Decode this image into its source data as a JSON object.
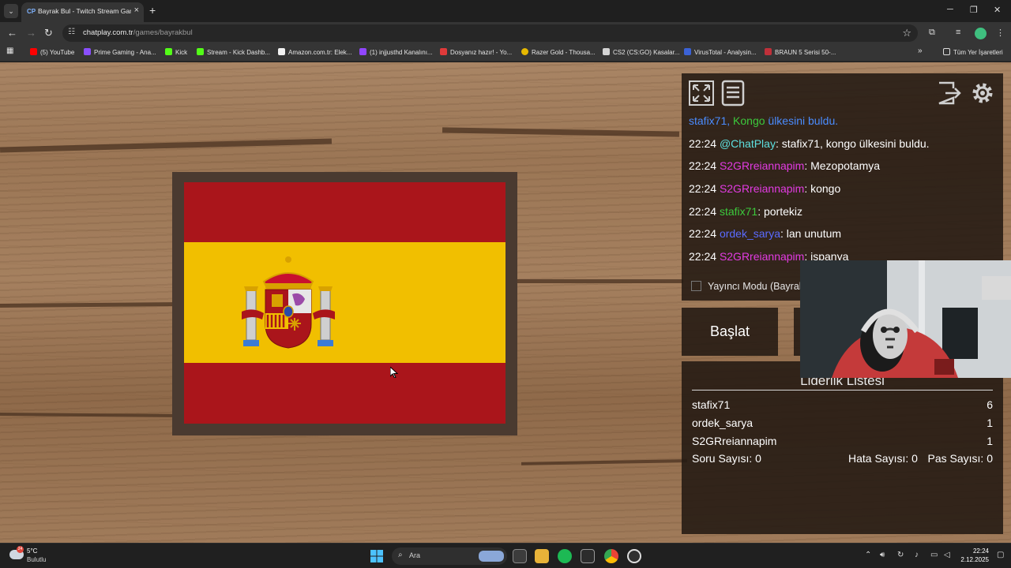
{
  "browser": {
    "tab": {
      "favicon": "CP",
      "title": "Bayrak Bul - Twitch Stream Game"
    },
    "url": {
      "host": "chatplay.com.tr",
      "path": "/games/bayrakbul"
    },
    "bookmarks": [
      {
        "label": "(5) YouTube",
        "color": "#ff0000"
      },
      {
        "label": "Prime Gaming - Ana...",
        "color": "#8a4fff"
      },
      {
        "label": "Kick",
        "color": "#53fc18"
      },
      {
        "label": "Stream - Kick Dashb...",
        "color": "#53fc18"
      },
      {
        "label": "Amazon.com.tr: Elek...",
        "color": "#f2f2f2"
      },
      {
        "label": "(1) injjusthd Kanalını...",
        "color": "#9146ff"
      },
      {
        "label": "Dosyanız hazır! - Yo...",
        "color": "#e03a3a"
      },
      {
        "label": "Razer Gold - Thousa...",
        "color": "#e6b800"
      },
      {
        "label": "CS2 (CS:GO) Kasalar...",
        "color": "#d4d4d4"
      },
      {
        "label": "VirusTotal - Analysin...",
        "color": "#3b62d6"
      },
      {
        "label": "BRAUN 5 Serisi 50-...",
        "color": "#c0303a"
      }
    ],
    "all_bookmarks": "Tüm Yer İşaretleri"
  },
  "game": {
    "flag_colors": {
      "red": "#aa151b",
      "yellow": "#f1bf00"
    }
  },
  "chat": {
    "messages": [
      {
        "time": "",
        "user": "stafix71,",
        "user_color": "u-blue",
        "text_parts": [
          {
            "t": " Kongo",
            "c": "u-green"
          },
          {
            "t": " ülkesini buldu.",
            "c": "u-blue"
          }
        ]
      },
      {
        "time": "22:24",
        "user": "@ChatPlay",
        "user_color": "u-cyan",
        "text": ": stafix71, kongo ülkesini buldu."
      },
      {
        "time": "22:24",
        "user": "S2GRreiannapim",
        "user_color": "u-mag",
        "text": ": Mezopotamya"
      },
      {
        "time": "22:24",
        "user": "S2GRreiannapim",
        "user_color": "u-mag",
        "text": ": kongo"
      },
      {
        "time": "22:24",
        "user": "stafix71",
        "user_color": "u-green",
        "text": ": portekiz"
      },
      {
        "time": "22:24",
        "user": "ordek_sarya",
        "user_color": "u-slate",
        "text": ": lan unutum"
      },
      {
        "time": "22:24",
        "user": "S2GRreiannapim",
        "user_color": "u-mag",
        "text": ": ispanya"
      }
    ],
    "streamer_mode": "Yayıncı Modu (Bayrak"
  },
  "controls": {
    "start": "Başlat"
  },
  "leaderboard": {
    "title": "Liderlik Listesi",
    "rows": [
      {
        "name": "stafix71",
        "score": "6"
      },
      {
        "name": "ordek_sarya",
        "score": "1"
      },
      {
        "name": "S2GRreiannapim",
        "score": "1"
      }
    ],
    "questions": "Soru Sayısı: 0",
    "errors": "Hata Sayısı: 0",
    "passes": "Pas Sayısı: 0"
  },
  "taskbar": {
    "temperature": "5°C",
    "weather": "Bulutlu",
    "search_placeholder": "Ara",
    "weather_badge": "24",
    "time": "22:24",
    "date": "2.12.2025"
  }
}
